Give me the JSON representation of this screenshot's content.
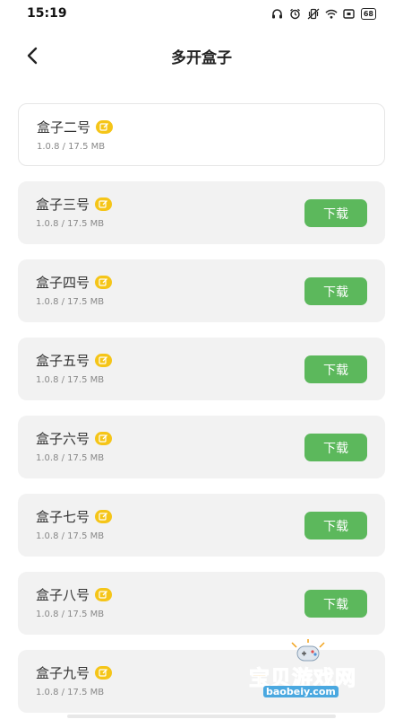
{
  "status_bar": {
    "time": "15:19",
    "battery": "68"
  },
  "header": {
    "title": "多开盒子",
    "back_icon": "chevron-left-icon"
  },
  "colors": {
    "download_button": "#5cb85c",
    "edit_badge": "#f5c518",
    "card_bg": "#f2f2f2"
  },
  "boxes": [
    {
      "name": "盒子二号",
      "meta": "1.0.8 / 17.5 MB",
      "action": ""
    },
    {
      "name": "盒子三号",
      "meta": "1.0.8 / 17.5 MB",
      "action": "下载"
    },
    {
      "name": "盒子四号",
      "meta": "1.0.8 / 17.5 MB",
      "action": "下载"
    },
    {
      "name": "盒子五号",
      "meta": "1.0.8 / 17.5 MB",
      "action": "下载"
    },
    {
      "name": "盒子六号",
      "meta": "1.0.8 / 17.5 MB",
      "action": "下载"
    },
    {
      "name": "盒子七号",
      "meta": "1.0.8 / 17.5 MB",
      "action": "下载"
    },
    {
      "name": "盒子八号",
      "meta": "1.0.8 / 17.5 MB",
      "action": "下载"
    },
    {
      "name": "盒子九号",
      "meta": "1.0.8 / 17.5 MB",
      "action": ""
    }
  ],
  "watermark": {
    "text": "宝贝游戏网",
    "url": "baobeiy.com"
  }
}
